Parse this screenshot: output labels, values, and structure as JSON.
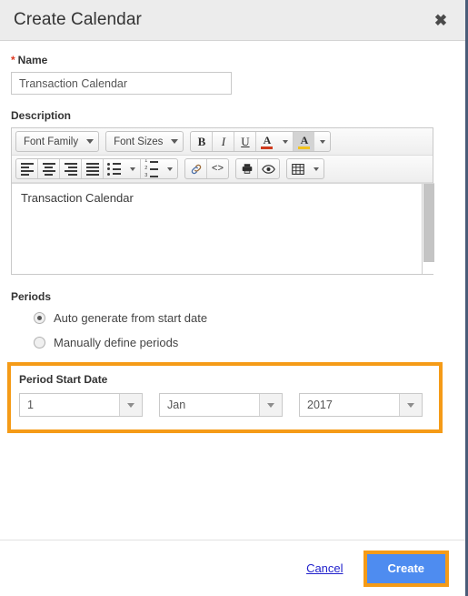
{
  "dialog": {
    "title": "Create Calendar",
    "close_icon": "close-icon"
  },
  "name_field": {
    "label": "Name",
    "required_marker": "*",
    "value": "Transaction Calendar",
    "placeholder": ""
  },
  "description": {
    "label": "Description",
    "content": "Transaction Calendar",
    "toolbar": {
      "font_family_label": "Font Family",
      "font_sizes_label": "Font Sizes",
      "bold_label": "B",
      "italic_label": "I",
      "underline_label": "U",
      "text_color_label": "A",
      "background_color_label": "A",
      "icons": {
        "font_family": "font-family-select",
        "font_sizes": "font-sizes-select",
        "bold": "bold-icon",
        "italic": "italic-icon",
        "underline": "underline-icon",
        "text_color": "text-color-icon",
        "background_color": "background-color-icon",
        "align_left": "align-left-icon",
        "align_center": "align-center-icon",
        "align_right": "align-right-icon",
        "align_justify": "align-justify-icon",
        "bullet_list": "bullet-list-icon",
        "numbered_list": "numbered-list-icon",
        "link": "link-icon",
        "source_code": "source-code-icon",
        "print": "print-icon",
        "preview": "preview-eye-icon",
        "table": "table-icon"
      }
    }
  },
  "periods": {
    "label": "Periods",
    "options": [
      {
        "label": "Auto generate from start date",
        "selected": true
      },
      {
        "label": "Manually define periods",
        "selected": false
      }
    ]
  },
  "period_start_date": {
    "label": "Period Start Date",
    "day": "1",
    "month": "Jan",
    "year": "2017"
  },
  "footer": {
    "cancel_label": "Cancel",
    "create_label": "Create"
  },
  "colors": {
    "highlight": "#f59b17",
    "primary_button": "#4e8cf0",
    "link": "#2222cc",
    "required": "#e03a22",
    "header_bg": "#ececec"
  }
}
